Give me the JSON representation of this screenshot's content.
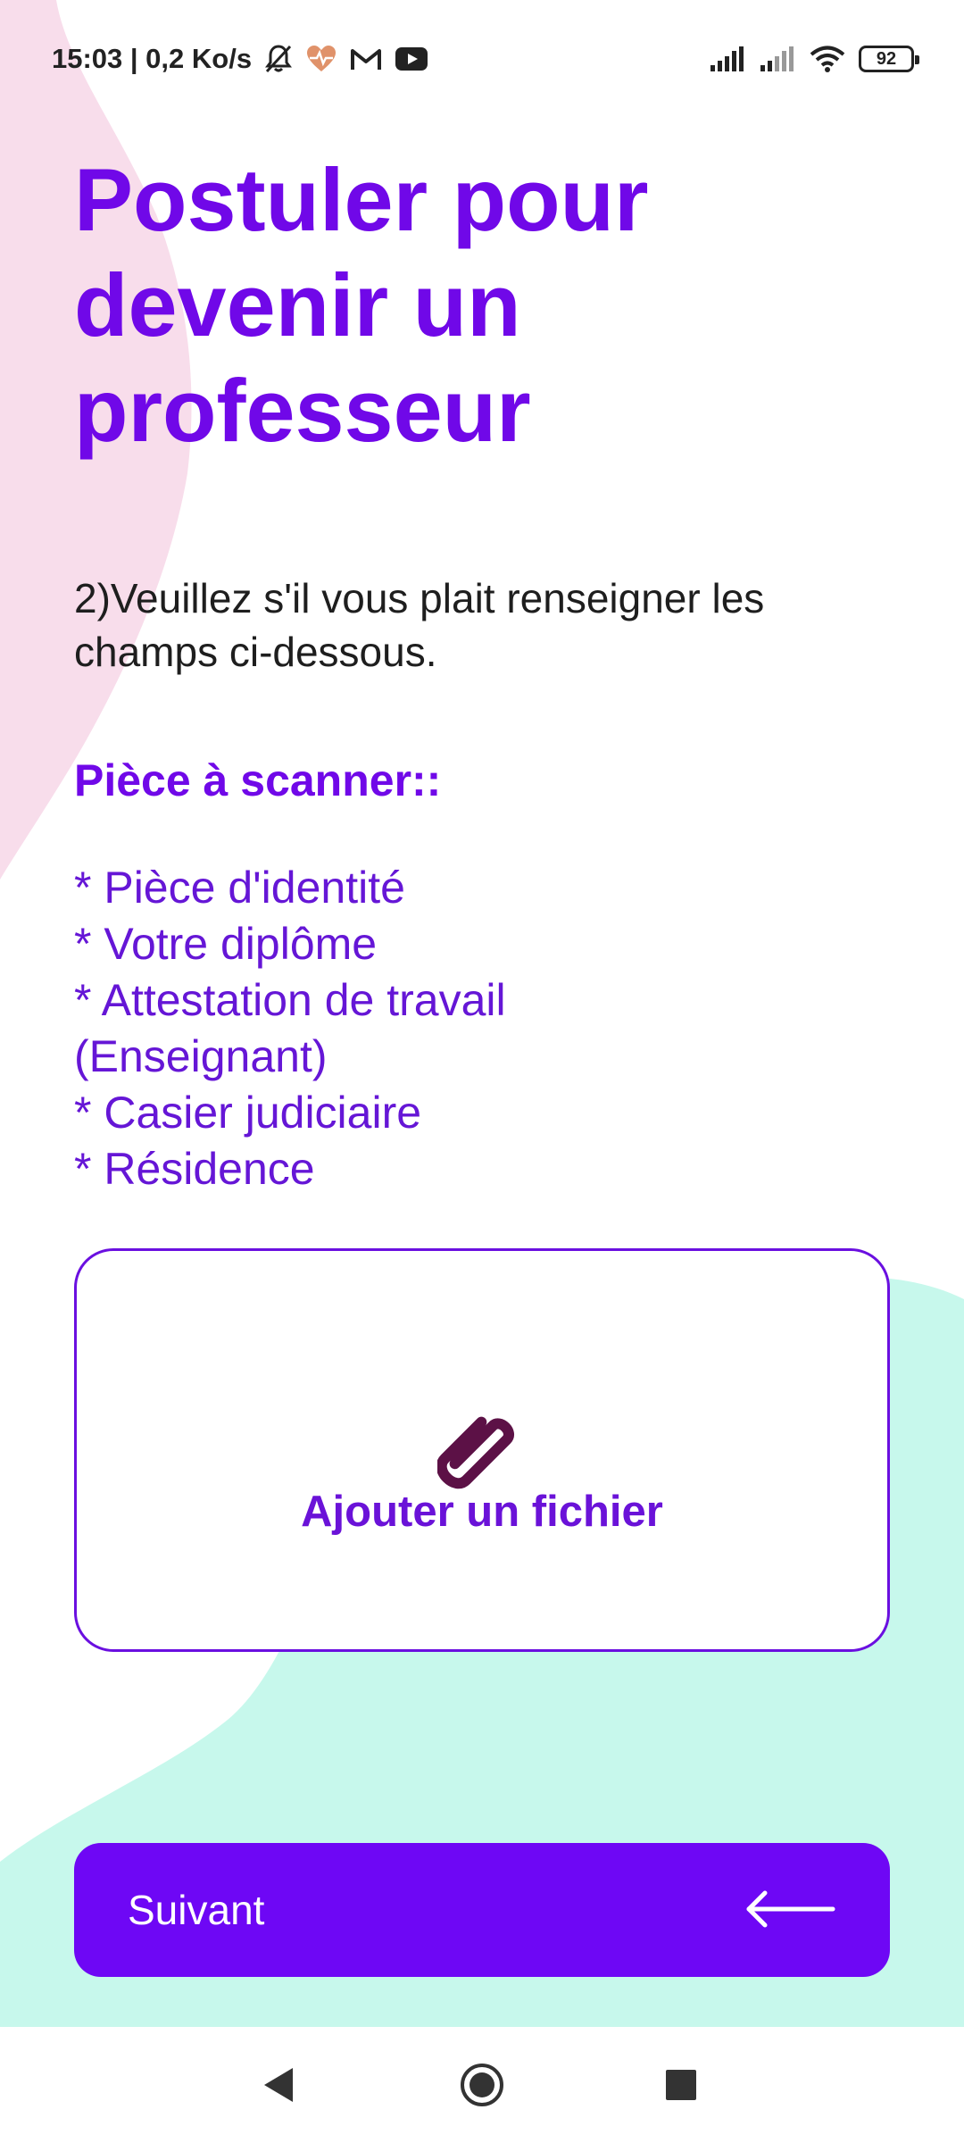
{
  "status_bar": {
    "time_speed": "15:03 | 0,2 Ko/s",
    "battery": "92",
    "icons": [
      "bell-off-icon",
      "health-icon",
      "gmail-icon",
      "youtube-icon",
      "signal-icon",
      "signal-icon",
      "wifi-icon",
      "battery-icon"
    ]
  },
  "page": {
    "title": "Postuler pour devenir un professeur",
    "instructions": "2)Veuillez s'il vous plait renseigner les champs ci-dessous.",
    "section_label": "Pièce à scanner::",
    "documents": [
      "* Pièce d'identité",
      "* Votre diplôme",
      "* Attestation de travail (Enseignant)",
      "* Casier judiciaire",
      "* Résidence"
    ]
  },
  "upload": {
    "label": "Ajouter un fichier",
    "icon": "paperclip-icon"
  },
  "next_button": {
    "label": "Suivant",
    "icon": "arrow-left-icon"
  },
  "nav_bar": {
    "icons": [
      "back-icon",
      "home-icon",
      "recents-icon"
    ]
  },
  "colors": {
    "primary": "#6E07F5",
    "title": "#7008E8",
    "list_text": "#6516D6",
    "pink_blob": "#F8DDEB",
    "mint_blob": "#C7F8EC",
    "clip": "#5C1146"
  }
}
